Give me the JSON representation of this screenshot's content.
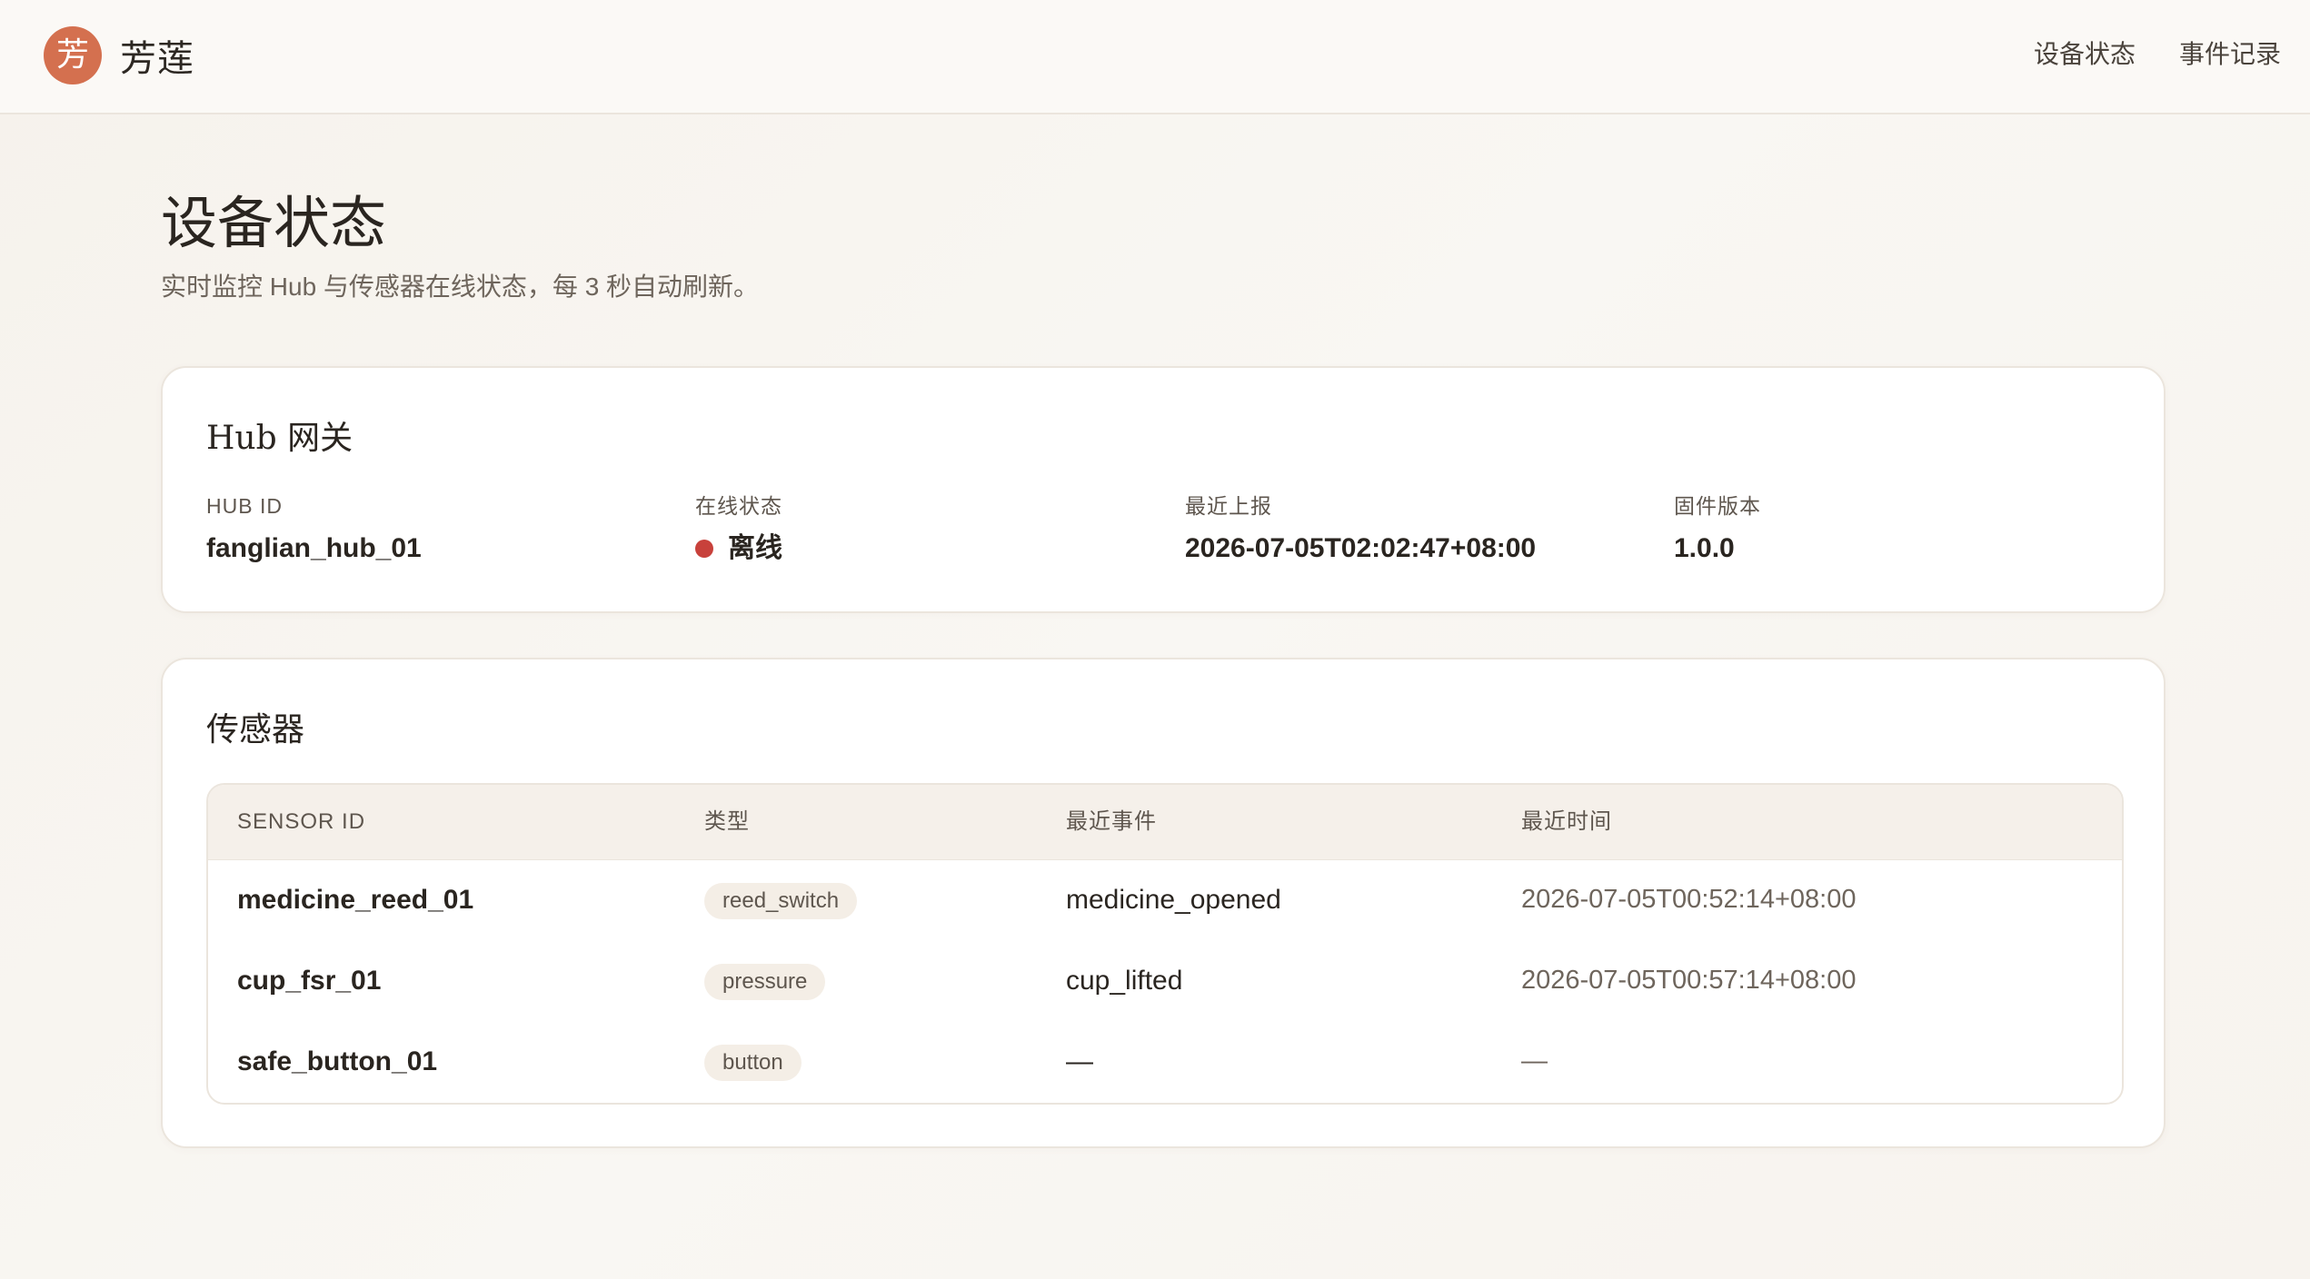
{
  "brand": {
    "logo_char": "芳",
    "name": "芳莲",
    "accent_color": "#d4704f"
  },
  "nav": {
    "items": [
      "设备状态",
      "事件记录"
    ]
  },
  "page": {
    "title": "设备状态",
    "subtitle": "实时监控 Hub 与传感器在线状态，每 3 秒自动刷新。"
  },
  "hub": {
    "title": "Hub 网关",
    "fields": [
      {
        "label": "HUB ID",
        "value": "fanglian_hub_01"
      },
      {
        "label": "在线状态",
        "value": "离线",
        "status_color": "#c8413b"
      },
      {
        "label": "最近上报",
        "value": "2026-07-05T02:02:47+08:00"
      },
      {
        "label": "固件版本",
        "value": "1.0.0"
      }
    ]
  },
  "sensors": {
    "title": "传感器",
    "columns": [
      "SENSOR ID",
      "类型",
      "最近事件",
      "最近时间"
    ],
    "rows": [
      {
        "id": "medicine_reed_01",
        "type": "reed_switch",
        "event": "medicine_opened",
        "time": "2026-07-05T00:52:14+08:00"
      },
      {
        "id": "cup_fsr_01",
        "type": "pressure",
        "event": "cup_lifted",
        "time": "2026-07-05T00:57:14+08:00"
      },
      {
        "id": "safe_button_01",
        "type": "button",
        "event": "—",
        "time": "—"
      }
    ]
  }
}
